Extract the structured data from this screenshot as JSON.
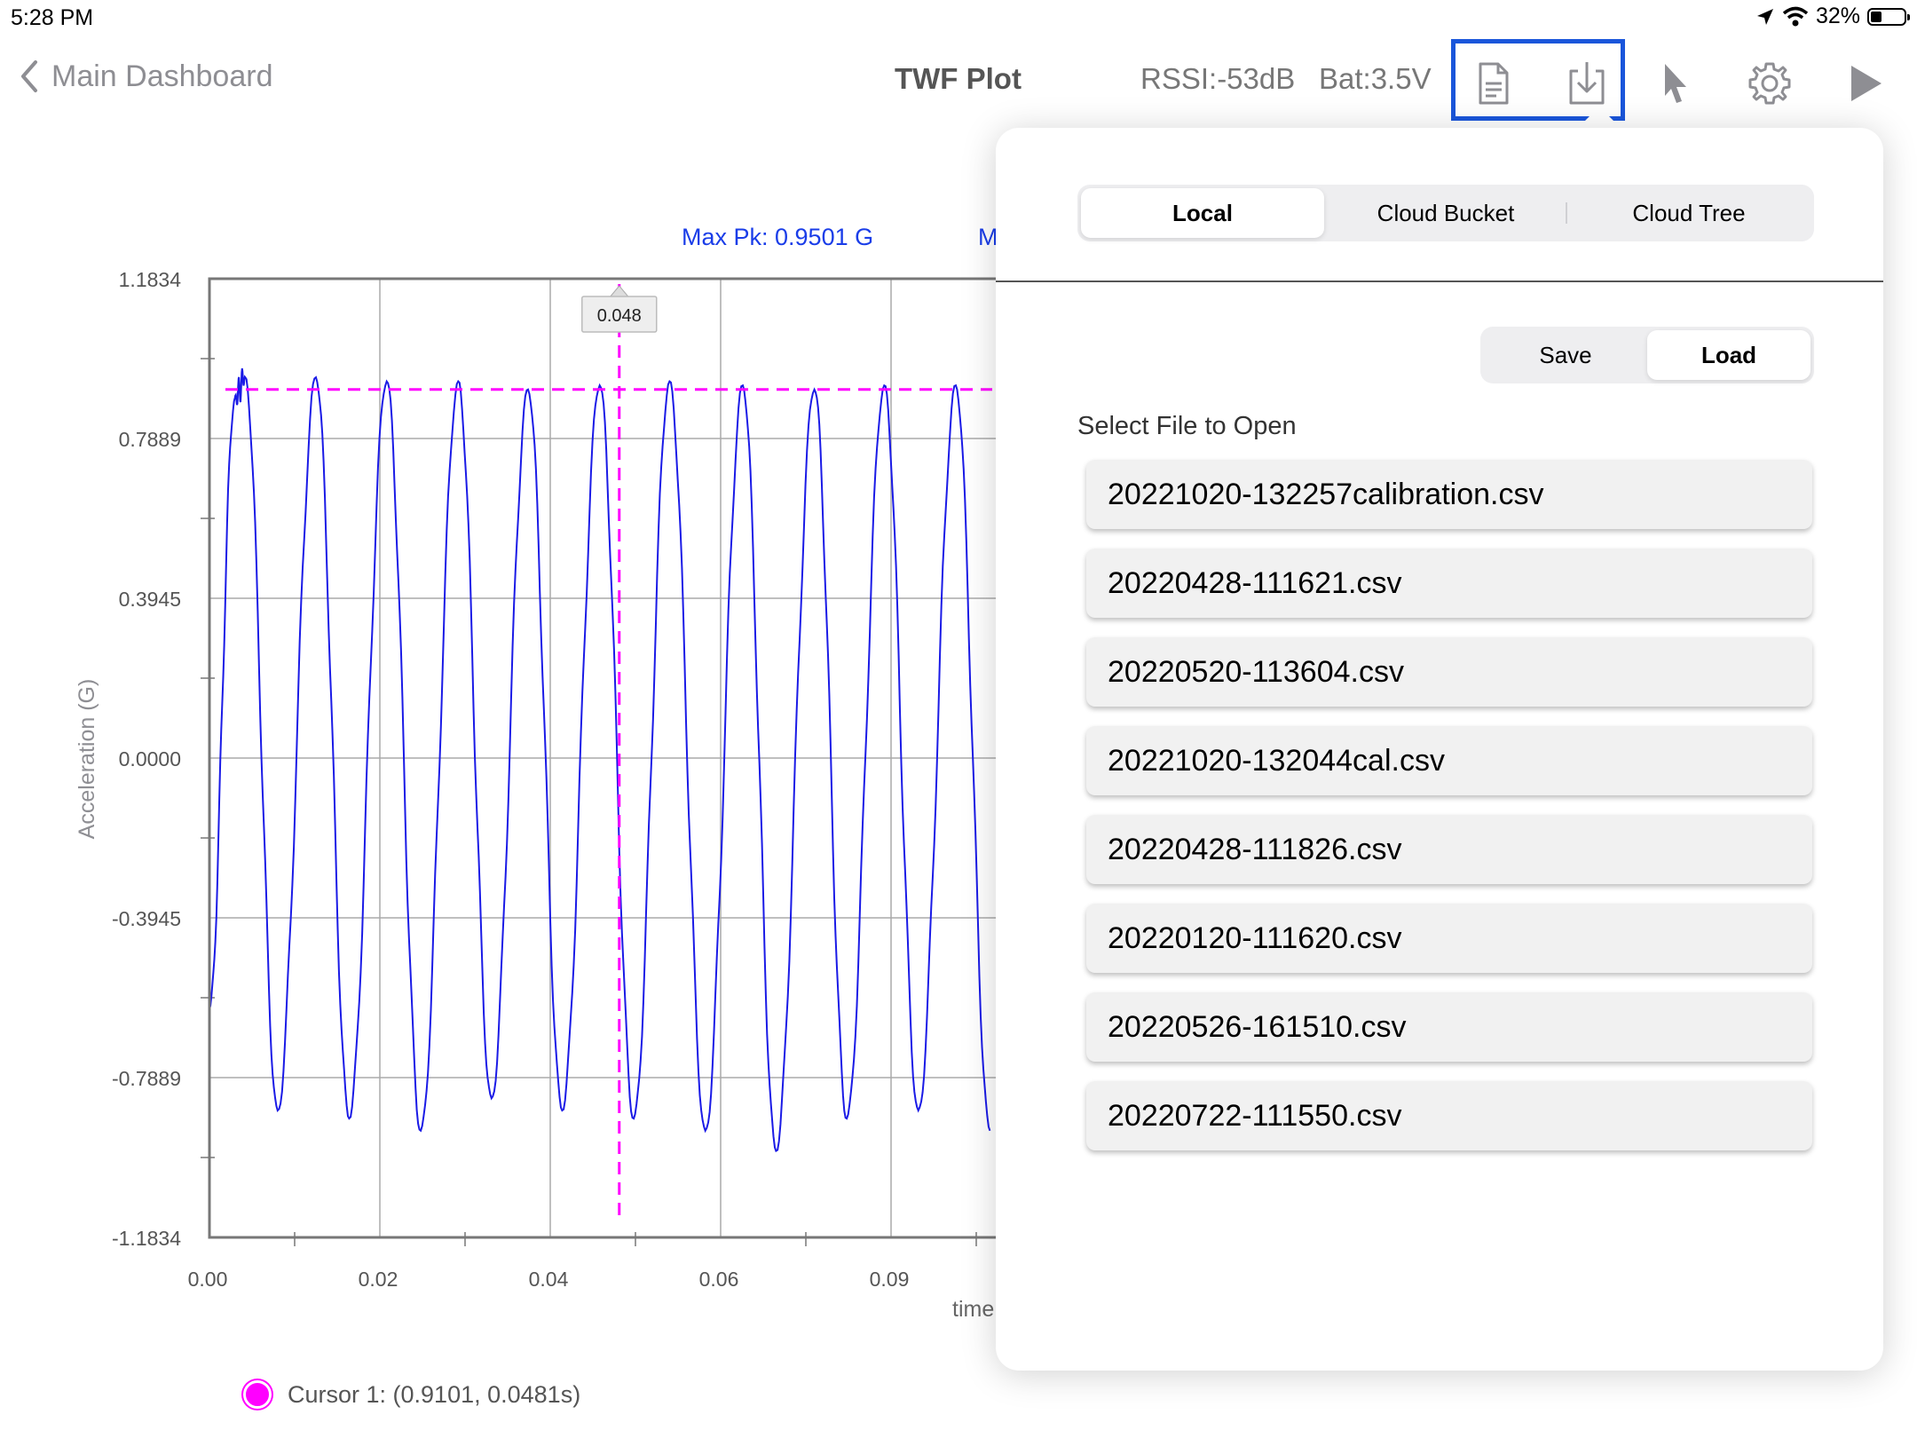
{
  "status_bar": {
    "time": "5:28 PM",
    "battery_percent": "32%",
    "battery_level": 0.32
  },
  "nav": {
    "back_label": "Main Dashboard",
    "title": "TWF Plot",
    "rssi": "RSSI:-53dB",
    "battery": "Bat:3.5V",
    "icons": [
      "document-icon",
      "download-icon",
      "pointer-icon",
      "gear-icon",
      "play-icon"
    ]
  },
  "chart": {
    "max_pk": "Max Pk: 0.9501 G",
    "second_stat_partial": "M",
    "cursor_tag": "0.048",
    "x_axis_label_partial": "time",
    "y_axis_label": "Acceleration (G)",
    "cursor_legend": "Cursor 1: (0.9101, 0.0481s)",
    "colors": {
      "signal": "#1a1ae6",
      "cursor": "#ff00ff",
      "grid": "#aaaaaa"
    }
  },
  "chart_data": {
    "type": "line",
    "ylabel": "Acceleration (G)",
    "xlabel": "time",
    "ylim": [
      -1.1834,
      1.1834
    ],
    "y_ticks": [
      "1.1834",
      "0.7889",
      "0.3945",
      "0.0000",
      "-0.3945",
      "-0.7889",
      "-1.1834"
    ],
    "x_ticks": [
      "0.00",
      "0.02",
      "0.04",
      "0.06",
      "0.09"
    ],
    "series": [
      {
        "x": [
          0.0,
          0.003,
          0.0042,
          0.008,
          0.0125,
          0.0164,
          0.0208,
          0.0248,
          0.0292,
          0.0331,
          0.0374,
          0.0414,
          0.0458,
          0.0498,
          0.054,
          0.0582,
          0.0626,
          0.0665,
          0.071,
          0.0748,
          0.0792,
          0.0832,
          0.0876,
          0.0916
        ],
        "y": [
          -0.62,
          0.89,
          0.94,
          -0.87,
          0.94,
          -0.89,
          0.93,
          -0.92,
          0.93,
          -0.84,
          0.91,
          -0.87,
          0.92,
          -0.89,
          0.93,
          -0.92,
          0.92,
          -0.97,
          0.91,
          -0.89,
          0.92,
          -0.87,
          0.92,
          -0.92
        ]
      }
    ],
    "cursor_x": 0.0481,
    "cursor_level": 0.9101,
    "grid": true
  },
  "popover": {
    "source_tabs": [
      "Local",
      "Cloud Bucket",
      "Cloud Tree"
    ],
    "source_active": 0,
    "mode_tabs": [
      "Save",
      "Load"
    ],
    "mode_active": 1,
    "file_label": "Select File to Open",
    "files": [
      "20221020-132257calibration.csv",
      "20220428-111621.csv",
      "20220520-113604.csv",
      "20221020-132044cal.csv",
      "20220428-111826.csv",
      "20220120-111620.csv",
      "20220526-161510.csv",
      "20220722-111550.csv"
    ]
  }
}
